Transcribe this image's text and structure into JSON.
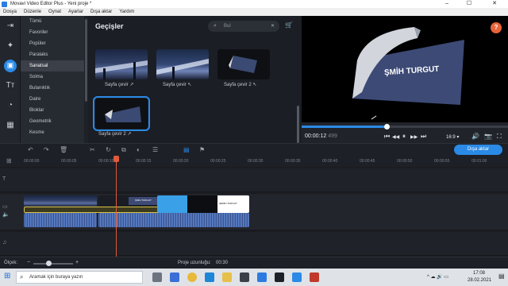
{
  "window": {
    "title": "Movavi Video Editor Plus - Yeni proje *",
    "minimize": "–",
    "maximize": "☐",
    "close": "✕"
  },
  "menu": [
    "Dosya",
    "Düzenle",
    "Oynat",
    "Ayarlar",
    "Dışa aktar",
    "Yardım"
  ],
  "left_tools": [
    {
      "icon": "import-icon",
      "glyph": "⇥"
    },
    {
      "icon": "magic-wand-icon",
      "glyph": "✦"
    },
    {
      "icon": "transitions-icon",
      "glyph": "▣"
    },
    {
      "icon": "titles-icon",
      "glyph": "Tт"
    },
    {
      "icon": "stickers-icon",
      "glyph": "◔"
    },
    {
      "icon": "more-tools-icon",
      "glyph": "▦"
    }
  ],
  "categories": [
    "Tümü",
    "Favoriler",
    "Popüler",
    "Paralaks",
    "Sanatsal",
    "Solma",
    "Bulanıklık",
    "Daire",
    "Bloklar",
    "Geometrik",
    "Kesme"
  ],
  "selected_category": "Sanatsal",
  "panel": {
    "title": "Geçişler",
    "search_placeholder": "Bul",
    "search_icon": "⌕",
    "clear_icon": "✕",
    "cart_icon": "🛒"
  },
  "transitions": [
    {
      "label": "Sayfa çevir ↗",
      "style": "bridge"
    },
    {
      "label": "Sayfa çevir ↖",
      "style": "bridge2"
    },
    {
      "label": "Sayfa çevir 2 ↖",
      "style": "dark"
    },
    {
      "label": "Sayfa çevir 2 ↗",
      "style": "dark"
    }
  ],
  "preview": {
    "overlay_text": "ŞMİH TURGUT",
    "timecode": "00:00:12",
    "timecode_ms": "499",
    "progress": 0.41,
    "aspect": "16:9 ▾",
    "help": "?"
  },
  "playback": {
    "prev": "⏮",
    "step_back": "◀◀",
    "play": "⏸",
    "step_fwd": "▶▶",
    "next": "⏭",
    "volume": "🔊",
    "snapshot": "📷",
    "fullscreen": "⛶"
  },
  "toolbar": {
    "undo": "↶",
    "redo": "↷",
    "delete": "🗑",
    "cut": "✂",
    "rotate": "↻",
    "crop": "⧉",
    "adjust": "◐",
    "properties": "☰",
    "clip_effects": "▤",
    "marker": "⚑",
    "export_label": "Dışa aktar"
  },
  "ruler": [
    "00:00:00",
    "00:00:05",
    "00:00:10",
    "00:00:15",
    "00:00:20",
    "00:00:25",
    "00:00:30",
    "00:00:35",
    "00:00:40",
    "00:00:45",
    "00:00:50",
    "00:00:55",
    "00:01:00"
  ],
  "clip_texts": {
    "title_card_1": "ŞMİH TURGUT",
    "title_card_2": "ŞEMİH TURGUT"
  },
  "status": {
    "scale_label": "Ölçek:",
    "zoom": 0.38,
    "duration_label": "Proje uzunluğu:",
    "duration": "00:30"
  },
  "taskbar": {
    "search_placeholder": "Aramak için buraya yazın",
    "time": "17:08",
    "date": "28.02.2021",
    "tray": "^ ☁ 🔊 ▭"
  }
}
